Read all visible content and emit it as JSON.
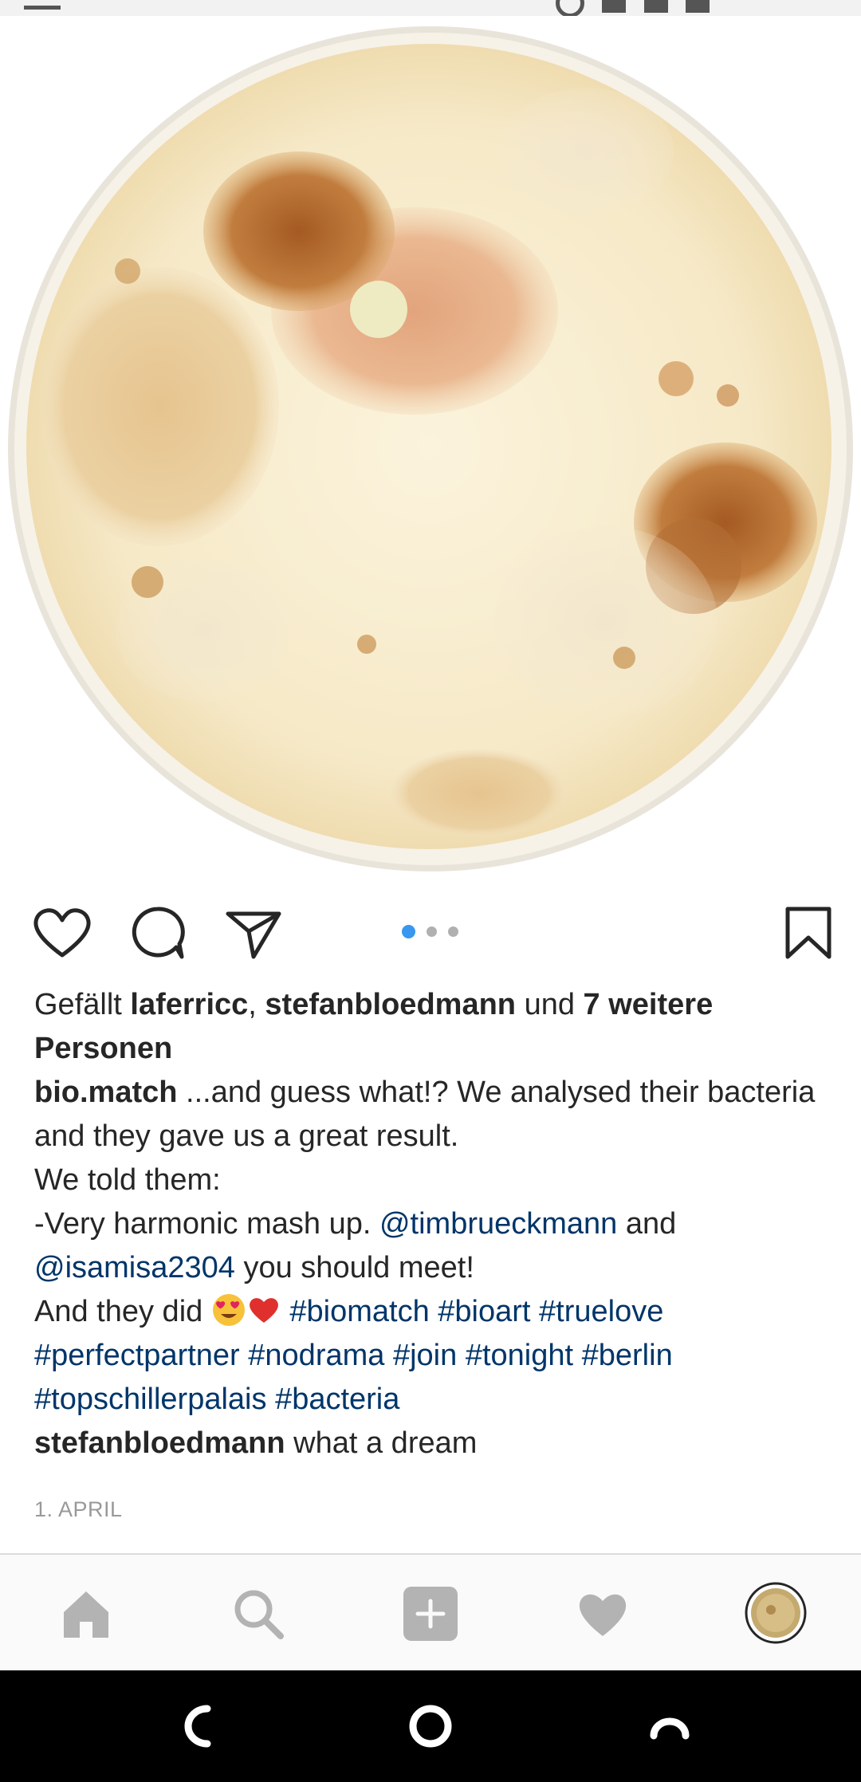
{
  "post": {
    "likes": {
      "prefix": "Gefällt ",
      "user1": "laferricc",
      "separator": ", ",
      "user2": "stefanbloedmann",
      "conjunction": " und ",
      "others": "7 weitere Personen"
    },
    "caption": {
      "username": "bio.match",
      "text1": " ...and guess what!? We analysed their bacteria and they gave us a great result.",
      "line2": "We told them:",
      "line3_prefix": "-Very harmonic mash up. ",
      "mention1": "@timbrueckmann",
      "line3_mid": " and ",
      "mention2": "@isamisa2304",
      "line3_suffix": " you should meet!",
      "line4_prefix": "And they did ",
      "hashtags": [
        "#biomatch",
        "#bioart",
        "#truelove",
        "#perfectpartner",
        "#nodrama",
        "#join",
        "#tonight",
        "#berlin",
        "#topschillerpalais",
        "#bacteria"
      ]
    },
    "comment": {
      "username": "stefanbloedmann",
      "text": " what a dream"
    },
    "date": "1. APRIL",
    "carousel": {
      "total": 3,
      "active_index": 0
    }
  },
  "icons": {
    "like": "heart-outline-icon",
    "comment": "comment-bubble-icon",
    "share": "paper-plane-icon",
    "save": "bookmark-icon"
  },
  "bottom_nav": [
    "home-icon",
    "search-icon",
    "add-post-icon",
    "activity-heart-icon",
    "profile-avatar"
  ],
  "colors": {
    "link": "#003569",
    "text": "#262626",
    "muted": "#999999",
    "carousel_active": "#3897f0",
    "nav_icon": "#b3b3b3"
  }
}
